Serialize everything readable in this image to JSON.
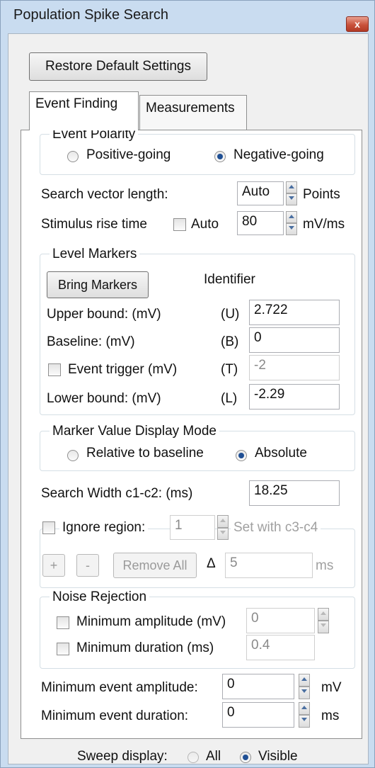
{
  "window": {
    "title": "Population Spike Search",
    "close_glyph": "x",
    "close_icon": "close-icon"
  },
  "restore_button": "Restore Default Settings",
  "tabs": [
    {
      "label": "Event Finding",
      "active": true
    },
    {
      "label": "Measurements",
      "active": false
    }
  ],
  "event_polarity": {
    "title": "Event Polarity",
    "positive": "Positive-going",
    "negative": "Negative-going",
    "selected": "negative"
  },
  "search_vector": {
    "label": "Search vector length:",
    "value": "Auto",
    "unit": "Points"
  },
  "stimulus_rise": {
    "label": "Stimulus rise time",
    "auto_label": "Auto",
    "auto_checked": false,
    "value": "80",
    "unit": "mV/ms"
  },
  "level_markers": {
    "title": "Level Markers",
    "bring_button": "Bring Markers",
    "identifier_header": "Identifier",
    "rows": [
      {
        "label": "Upper bound: (mV)",
        "id": "(U)",
        "value": "2.722",
        "checkbox": false,
        "enabled": true
      },
      {
        "label": "Baseline: (mV)",
        "id": "(B)",
        "value": "0",
        "checkbox": false,
        "enabled": true
      },
      {
        "label": "Event trigger (mV)",
        "id": "(T)",
        "value": "-2",
        "checkbox": true,
        "checked": false,
        "enabled": false
      },
      {
        "label": "Lower bound: (mV)",
        "id": "(L)",
        "value": "-2.29",
        "checkbox": false,
        "enabled": true
      }
    ]
  },
  "marker_display": {
    "title": "Marker Value Display Mode",
    "relative": "Relative to baseline",
    "absolute": "Absolute",
    "selected": "absolute"
  },
  "search_width": {
    "label": "Search Width c1-c2: (ms)",
    "value": "18.25"
  },
  "ignore_region": {
    "label": "Ignore region:",
    "checked": false,
    "value": "1",
    "set_with": "Set with c3-c4",
    "plus": "+",
    "minus": "-",
    "remove_all": "Remove All",
    "delta": "Δ",
    "delta_value": "5",
    "unit": "ms"
  },
  "noise_rejection": {
    "title": "Noise Rejection",
    "min_amp_label": "Minimum amplitude (mV)",
    "min_amp_value": "0",
    "min_amp_checked": false,
    "min_dur_label": "Minimum duration (ms)",
    "min_dur_value": "0.4",
    "min_dur_checked": false
  },
  "min_event_amp": {
    "label": "Minimum event amplitude:",
    "value": "0",
    "unit": "mV"
  },
  "min_event_dur": {
    "label": "Minimum event duration:",
    "value": "0",
    "unit": "ms"
  },
  "sweep_display": {
    "label": "Sweep display:",
    "all": "All",
    "visible": "Visible",
    "selected": "visible"
  },
  "colors": {
    "titlebar": "#c9dcf0",
    "close": "#c9523c",
    "radio_dot": "#1f4f94",
    "panel": "#ffffff"
  }
}
